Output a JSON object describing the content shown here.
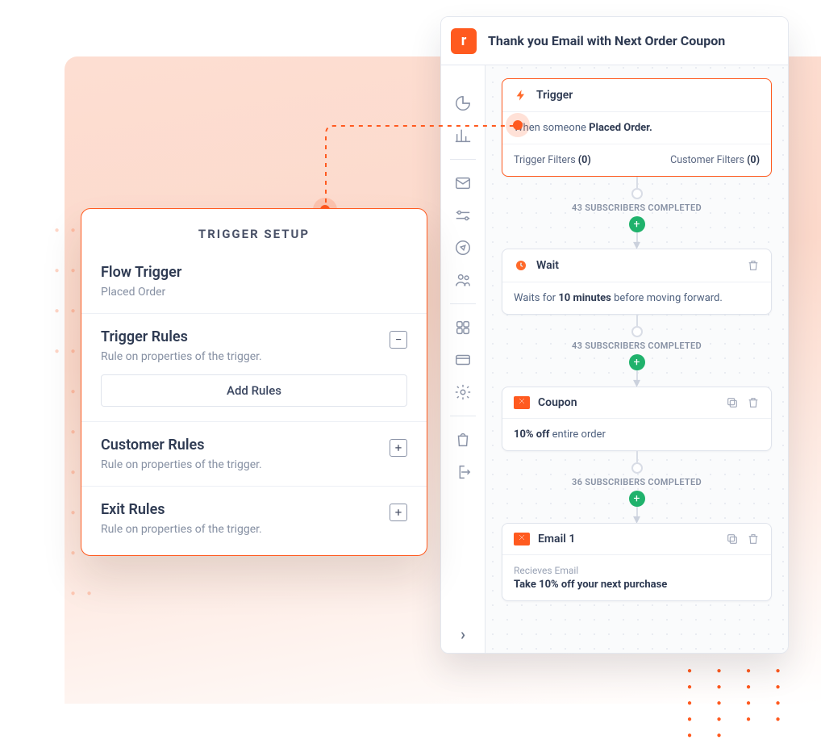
{
  "title": "Thank you Email with Next Order Coupon",
  "brand_letter": "r",
  "nav": {
    "expand_glyph": "›"
  },
  "setup": {
    "title": "TRIGGER SETUP",
    "flow_trigger": {
      "label": "Flow Trigger",
      "value": "Placed Order"
    },
    "trigger_rules": {
      "label": "Trigger Rules",
      "hint": "Rule on properties of the trigger.",
      "btn": "Add Rules"
    },
    "customer_rules": {
      "label": "Customer Rules",
      "hint": "Rule on properties of the trigger."
    },
    "exit_rules": {
      "label": "Exit Rules",
      "hint": "Rule on properties of the trigger."
    }
  },
  "flow": {
    "trigger": {
      "label": "Trigger",
      "text_a": "When someone ",
      "text_b": "Placed Order.",
      "filter1_label": "Trigger Filters ",
      "filter1_count": "(0)",
      "filter2_label": "Customer Filters ",
      "filter2_count": "(0)"
    },
    "stats": {
      "s1": "43 SUBSCRIBERS COMPLETED",
      "s2": "43 SUBSCRIBERS COMPLETED",
      "s3": "36 SUBSCRIBERS COMPLETED"
    },
    "wait": {
      "label": "Wait",
      "body_a": "Waits for ",
      "body_b": "10 minutes ",
      "body_c": "before moving forward."
    },
    "coupon": {
      "label": "Coupon",
      "body_a": "10% off ",
      "body_b": "entire order"
    },
    "email": {
      "label": "Email 1",
      "sub": "Recieves Email",
      "line": "Take 10% off your next purchase"
    }
  }
}
